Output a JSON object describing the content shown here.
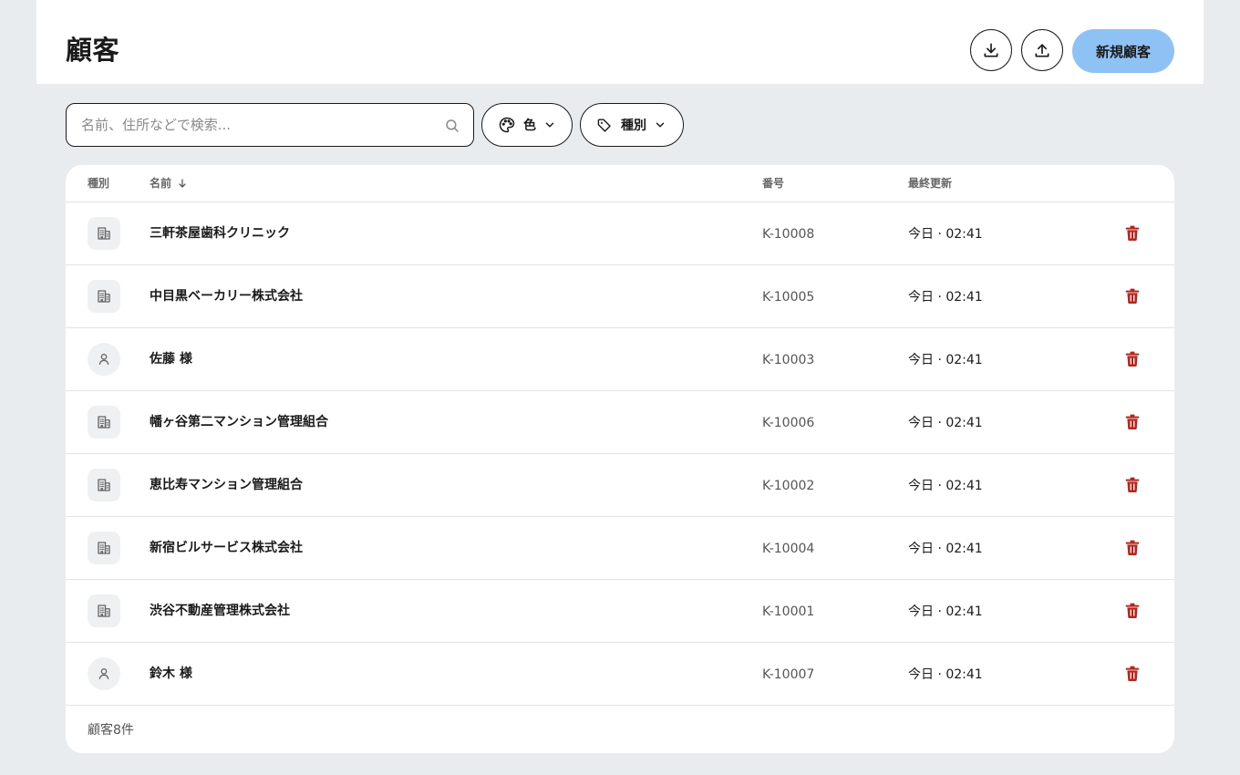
{
  "header": {
    "title": "顧客",
    "download_icon": "download-icon",
    "upload_icon": "upload-icon",
    "new_button_label": "新規顧客"
  },
  "filters": {
    "search_placeholder": "名前、住所などで検索...",
    "search_value": "",
    "color_label": "色",
    "type_label": "種別"
  },
  "table": {
    "columns": {
      "type": "種別",
      "name": "名前",
      "number": "番号",
      "updated": "最終更新"
    },
    "sort_icon": "arrow-down-icon",
    "rows": [
      {
        "type": "company",
        "icon": "building-icon",
        "name": "三軒茶屋歯科クリニック",
        "number": "K-10008",
        "updated": "今日 · 02:41"
      },
      {
        "type": "company",
        "icon": "building-icon",
        "name": "中目黒ベーカリー株式会社",
        "number": "K-10005",
        "updated": "今日 · 02:41"
      },
      {
        "type": "person",
        "icon": "person-icon",
        "name": "佐藤 様",
        "number": "K-10003",
        "updated": "今日 · 02:41"
      },
      {
        "type": "company",
        "icon": "building-icon",
        "name": "幡ヶ谷第二マンション管理組合",
        "number": "K-10006",
        "updated": "今日 · 02:41"
      },
      {
        "type": "company",
        "icon": "building-icon",
        "name": "恵比寿マンション管理組合",
        "number": "K-10002",
        "updated": "今日 · 02:41"
      },
      {
        "type": "company",
        "icon": "building-icon",
        "name": "新宿ビルサービス株式会社",
        "number": "K-10004",
        "updated": "今日 · 02:41"
      },
      {
        "type": "company",
        "icon": "building-icon",
        "name": "渋谷不動産管理株式会社",
        "number": "K-10001",
        "updated": "今日 · 02:41"
      },
      {
        "type": "person",
        "icon": "person-icon",
        "name": "鈴木 様",
        "number": "K-10007",
        "updated": "今日 · 02:41"
      }
    ],
    "footer": "顧客8件"
  },
  "colors": {
    "background": "#e8ecef",
    "accent": "#8fc2f4",
    "delete": "#b3261e",
    "badge": "#eef0f2"
  }
}
